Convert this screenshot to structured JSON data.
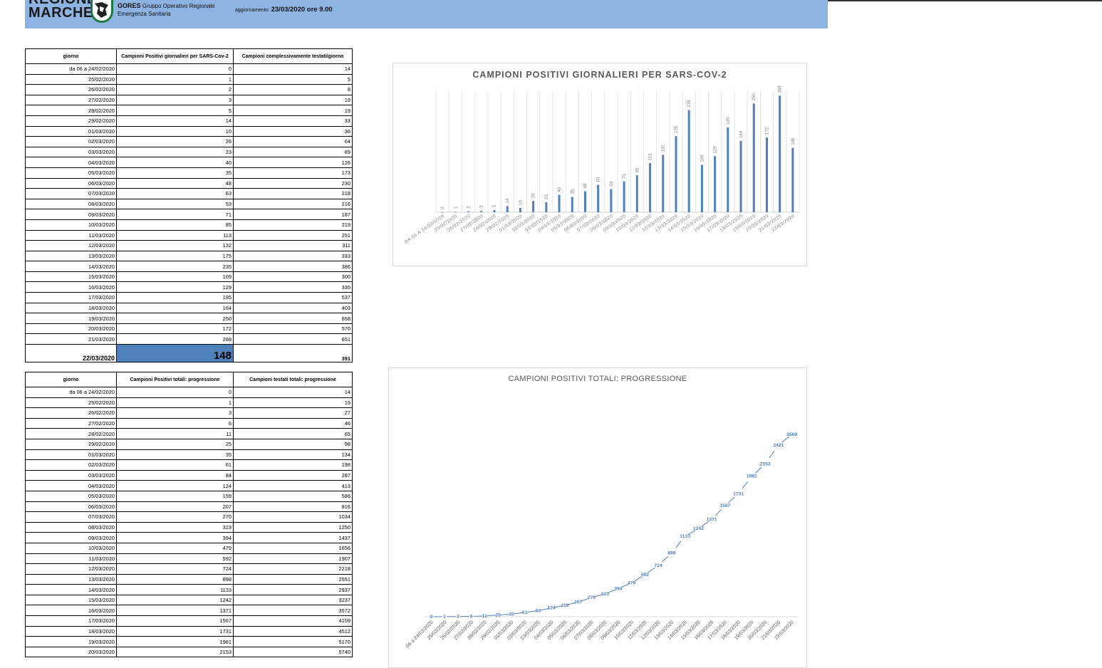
{
  "header": {
    "logo_line1": "REGIONE",
    "logo_line2": "MARCHE",
    "gores_name": "GORES",
    "gores_line1": "Gruppo Operativo Regionale",
    "gores_line2": "Emergenza Sanitaria",
    "update_label": "aggiornamento:",
    "update_value": "23/03/2020 ore 9.00"
  },
  "table1": {
    "headers": [
      "giorno",
      "Campioni Positivi giornalieri per SARS-Cov-2",
      "Campioni complessivamente testati/giorno"
    ],
    "rows": [
      [
        "da 06 a 24/02/2020",
        "0",
        "14"
      ],
      [
        "25/02/2020",
        "1",
        "5"
      ],
      [
        "26/02/2020",
        "2",
        "8"
      ],
      [
        "27/02/2020",
        "3",
        "19"
      ],
      [
        "28/02/2020",
        "5",
        "19"
      ],
      [
        "29/02/2020",
        "14",
        "33"
      ],
      [
        "01/03/2020",
        "10",
        "36"
      ],
      [
        "02/03/2020",
        "26",
        "64"
      ],
      [
        "03/03/2020",
        "23",
        "89"
      ],
      [
        "04/03/2020",
        "40",
        "126"
      ],
      [
        "05/03/2020",
        "35",
        "173"
      ],
      [
        "06/03/2020",
        "48",
        "230"
      ],
      [
        "07/03/2020",
        "63",
        "218"
      ],
      [
        "08/03/2020",
        "53",
        "216"
      ],
      [
        "09/03/2020",
        "71",
        "187"
      ],
      [
        "10/03/2020",
        "85",
        "219"
      ],
      [
        "11/03/2020",
        "113",
        "251"
      ],
      [
        "12/03/2020",
        "132",
        "311"
      ],
      [
        "13/03/2020",
        "175",
        "333"
      ],
      [
        "14/03/2020",
        "235",
        "386"
      ],
      [
        "15/03/2020",
        "109",
        "300"
      ],
      [
        "16/03/2020",
        "129",
        "335"
      ],
      [
        "17/03/2020",
        "195",
        "537"
      ],
      [
        "18/03/2020",
        "164",
        "403"
      ],
      [
        "19/03/2020",
        "250",
        "658"
      ],
      [
        "20/03/2020",
        "172",
        "570"
      ],
      [
        "21/03/2020",
        "268",
        "651"
      ]
    ],
    "total": [
      "22/03/2020",
      "148",
      "391"
    ],
    "highlight_color": "#4f81bd"
  },
  "table2": {
    "headers": [
      "giorno",
      "Campioni Positivi totali: progressione",
      "Campioni testati totali: progressione"
    ],
    "rows": [
      [
        "da 06 a 24/02/2020",
        "0",
        "14"
      ],
      [
        "25/02/2020",
        "1",
        "19"
      ],
      [
        "26/02/2020",
        "3",
        "27"
      ],
      [
        "27/02/2020",
        "6",
        "46"
      ],
      [
        "28/02/2020",
        "11",
        "65"
      ],
      [
        "29/02/2020",
        "25",
        "98"
      ],
      [
        "01/03/2020",
        "35",
        "134"
      ],
      [
        "02/03/2020",
        "61",
        "198"
      ],
      [
        "03/03/2020",
        "84",
        "287"
      ],
      [
        "04/03/2020",
        "124",
        "413"
      ],
      [
        "05/03/2020",
        "159",
        "586"
      ],
      [
        "06/03/2020",
        "207",
        "816"
      ],
      [
        "07/03/2020",
        "270",
        "1034"
      ],
      [
        "08/03/2020",
        "323",
        "1250"
      ],
      [
        "09/03/2020",
        "394",
        "1437"
      ],
      [
        "10/03/2020",
        "479",
        "1656"
      ],
      [
        "11/03/2020",
        "592",
        "1907"
      ],
      [
        "12/03/2020",
        "724",
        "2218"
      ],
      [
        "13/03/2020",
        "898",
        "2551"
      ],
      [
        "14/03/2020",
        "1133",
        "2937"
      ],
      [
        "15/03/2020",
        "1242",
        "3237"
      ],
      [
        "16/03/2020",
        "1371",
        "3572"
      ],
      [
        "17/03/2020",
        "1567",
        "4109"
      ],
      [
        "18/03/2020",
        "1731",
        "4512"
      ],
      [
        "19/03/2020",
        "1981",
        "5170"
      ],
      [
        "20/03/2020",
        "2153",
        "5740"
      ]
    ]
  },
  "chart_data": [
    {
      "type": "bar",
      "title": "CAMPIONI POSITIVI GIORNALIERI PER SARS-COV-2",
      "categories": [
        "DA 06 A 24/02/2020",
        "25/02/2020",
        "26/02/2020",
        "27/02/2020",
        "28/02/2020",
        "29/02/2020",
        "01/03/2020",
        "02/03/2020",
        "03/03/2020",
        "04/03/2020",
        "05/03/2020",
        "06/03/2020",
        "07/03/2020",
        "08/03/2020",
        "09/03/2020",
        "10/03/2020",
        "11/03/2020",
        "12/03/2020",
        "13/03/2020",
        "14/03/2020",
        "15/03/2020",
        "16/03/2020",
        "17/03/2020",
        "18/03/2020",
        "19/03/2020",
        "20/03/2020",
        "21/03/2020",
        "22/03/2020"
      ],
      "values": [
        0,
        1,
        2,
        3,
        5,
        14,
        10,
        26,
        23,
        40,
        35,
        48,
        63,
        53,
        71,
        85,
        113,
        132,
        175,
        235,
        109,
        129,
        195,
        164,
        250,
        172,
        268,
        148
      ],
      "ylim": [
        0,
        280
      ],
      "grid": true,
      "color": "#4f81bd"
    },
    {
      "type": "line",
      "title": "CAMPIONI POSITIVI TOTALI: PROGRESSIONE",
      "categories": [
        "06 a 24/02/2020",
        "25/02/2020",
        "26/02/2020",
        "27/02/2020",
        "28/02/2020",
        "29/02/2020",
        "01/03/2020",
        "02/03/2020",
        "03/03/2020",
        "04/03/2020",
        "05/03/2020",
        "06/03/2020",
        "07/03/2020",
        "08/03/2020",
        "09/03/2020",
        "10/03/2020",
        "11/03/2020",
        "12/03/2020",
        "13/03/2020",
        "14/03/2020",
        "15/03/2020",
        "16/03/2020",
        "17/03/2020",
        "18/03/2020",
        "19/03/2020",
        "20/03/2020",
        "21/03/2020",
        "22/03/2020"
      ],
      "values": [
        0,
        1,
        3,
        6,
        11,
        25,
        35,
        61,
        84,
        124,
        159,
        207,
        270,
        323,
        394,
        479,
        592,
        724,
        898,
        1133,
        1242,
        1371,
        1567,
        1731,
        1981,
        2153,
        2421,
        2569
      ],
      "ylim": [
        0,
        2800
      ],
      "grid": false,
      "color": "#4f81bd"
    }
  ]
}
